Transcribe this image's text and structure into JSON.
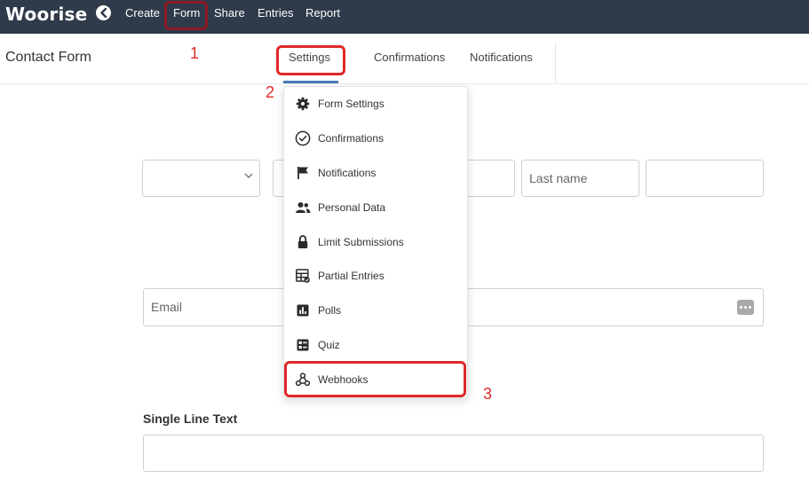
{
  "app": {
    "logo": "Woorise"
  },
  "nav": {
    "items": [
      "Create",
      "Form",
      "Share",
      "Entries",
      "Report"
    ]
  },
  "header": {
    "title": "Contact Form",
    "tabs": [
      "Settings",
      "Confirmations",
      "Notifications"
    ]
  },
  "form": {
    "last_name_placeholder": "Last name",
    "email_placeholder": "Email",
    "single_line_label": "Single Line Text"
  },
  "settings_menu": {
    "items": [
      {
        "label": "Form Settings",
        "icon": "gear-icon"
      },
      {
        "label": "Confirmations",
        "icon": "check-circle-icon"
      },
      {
        "label": "Notifications",
        "icon": "flag-icon"
      },
      {
        "label": "Personal Data",
        "icon": "users-icon"
      },
      {
        "label": "Limit Submissions",
        "icon": "lock-icon"
      },
      {
        "label": "Partial Entries",
        "icon": "table-icon"
      },
      {
        "label": "Polls",
        "icon": "bar-chart-icon"
      },
      {
        "label": "Quiz",
        "icon": "quiz-icon"
      },
      {
        "label": "Webhooks",
        "icon": "webhook-icon"
      }
    ]
  },
  "annotations": {
    "step1": "1",
    "step2": "2",
    "step3": "3"
  },
  "colors": {
    "topbar": "#2f3a4a",
    "accent": "#4a7ab8",
    "annotation": "#e02828"
  }
}
